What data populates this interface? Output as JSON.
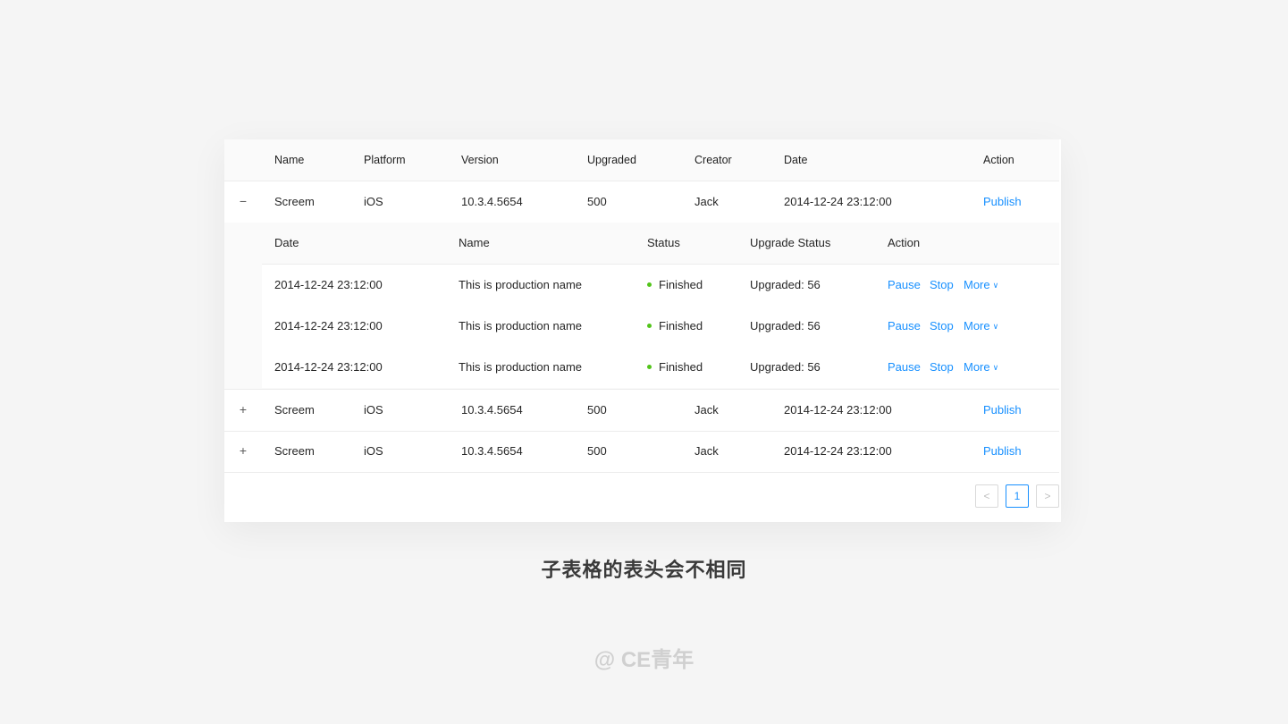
{
  "table": {
    "columns": {
      "name": "Name",
      "platform": "Platform",
      "version": "Version",
      "upgraded": "Upgraded",
      "creator": "Creator",
      "date": "Date",
      "action": "Action"
    },
    "rows": [
      {
        "expanded": true,
        "expand_icon": "−",
        "name": "Screem",
        "platform": "iOS",
        "version": "10.3.4.5654",
        "upgraded": "500",
        "creator": "Jack",
        "date": "2014-12-24 23:12:00",
        "action": "Publish"
      },
      {
        "expanded": false,
        "expand_icon": "+",
        "name": "Screem",
        "platform": "iOS",
        "version": "10.3.4.5654",
        "upgraded": "500",
        "creator": "Jack",
        "date": "2014-12-24 23:12:00",
        "action": "Publish"
      },
      {
        "expanded": false,
        "expand_icon": "+",
        "name": "Screem",
        "platform": "iOS",
        "version": "10.3.4.5654",
        "upgraded": "500",
        "creator": "Jack",
        "date": "2014-12-24 23:12:00",
        "action": "Publish"
      }
    ]
  },
  "subtable": {
    "columns": {
      "date": "Date",
      "name": "Name",
      "status": "Status",
      "upgrade_status": "Upgrade Status",
      "action": "Action"
    },
    "rows": [
      {
        "date": "2014-12-24 23:12:00",
        "name": "This is production name",
        "status": "Finished",
        "upgrade_status": "Upgraded: 56",
        "pause": "Pause",
        "stop": "Stop",
        "more": "More"
      },
      {
        "date": "2014-12-24 23:12:00",
        "name": "This is production name",
        "status": "Finished",
        "upgrade_status": "Upgraded: 56",
        "pause": "Pause",
        "stop": "Stop",
        "more": "More"
      },
      {
        "date": "2014-12-24 23:12:00",
        "name": "This is production name",
        "status": "Finished",
        "upgrade_status": "Upgraded: 56",
        "pause": "Pause",
        "stop": "Stop",
        "more": "More"
      }
    ],
    "status_color": "#52c41a"
  },
  "pagination": {
    "prev": "<",
    "current": "1",
    "next": ">"
  },
  "caption": "子表格的表头会不相同",
  "watermark": "@ CE青年",
  "colors": {
    "link": "#1890ff",
    "background": "#f5f5f5"
  }
}
